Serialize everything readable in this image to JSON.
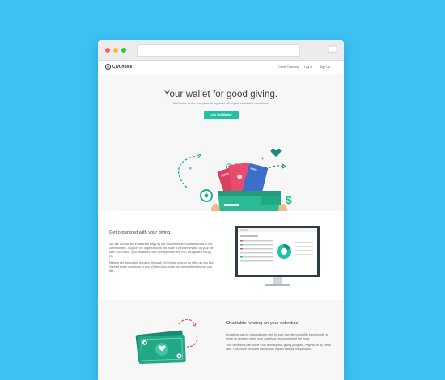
{
  "brand": {
    "name": "CivChoice"
  },
  "nav": {
    "links": [
      "Charity Directory",
      "Log In",
      "Sign Up"
    ]
  },
  "hero": {
    "title": "Your wallet for good giving.",
    "subtitle": "CivChoice is the one place to organize all of your charitable donations.",
    "cta": "Let's Get Started"
  },
  "feature1": {
    "title": "Get organized with your giving.",
    "paragraphs": [
      "We are all touched in different ways by the volunteers and professionals in our communities. Support the organizations that have a positive impact on your life. With CivChoice, your donations can directly reach any IRS-recognized 501(c)(3).",
      "Make a tax-deductible donation through CivChoice once or as often as you like. Spread those donations in your Giving Account to any nonprofit whenever you like."
    ]
  },
  "feature2": {
    "title": "Charitable funding on your schedule.",
    "paragraphs": [
      "Donations can be automatically sent to your favorite nonprofits each month or given on demand when your charity of choice needs it the most.",
      "Your donations can come from a workplace giving program, PayPal, or by credit card. CivChoice provides continuous impact without complication."
    ]
  },
  "colors": {
    "background": "#3bc2f3",
    "accent": "#21c2a4",
    "pink": "#e94b6d",
    "dark_green": "#1a8a74"
  }
}
